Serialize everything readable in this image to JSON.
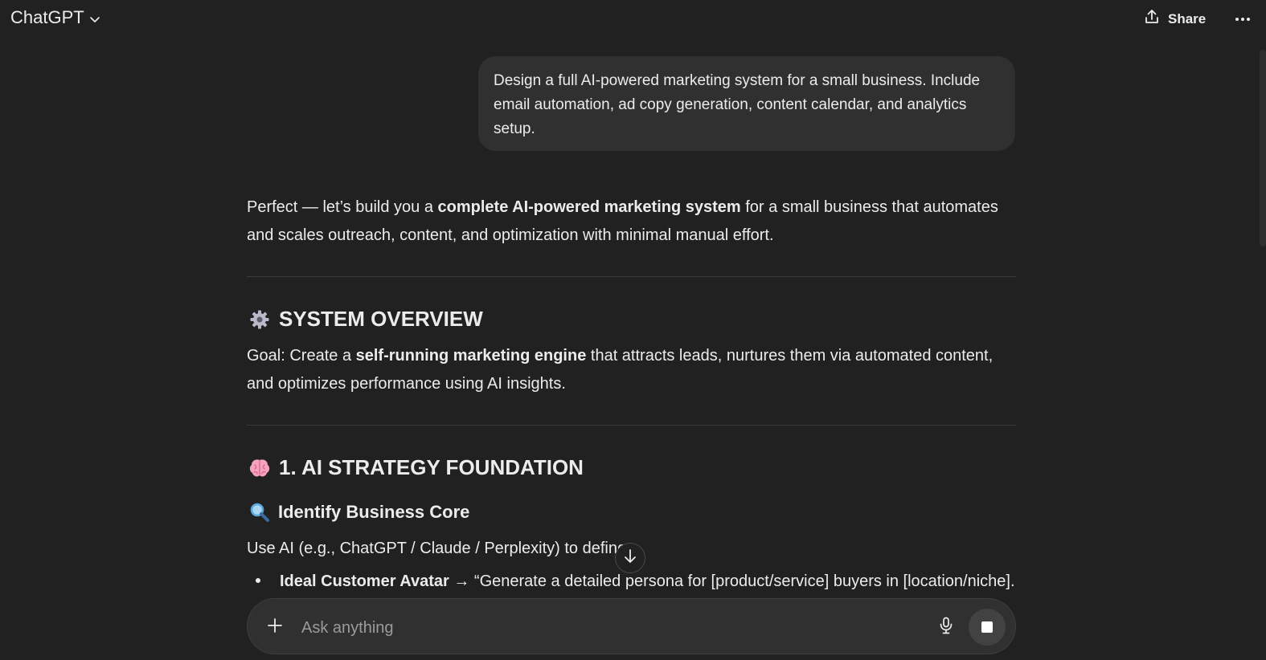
{
  "header": {
    "model_name": "ChatGPT",
    "share_label": "Share",
    "icons": [
      "chevron-down-icon",
      "share-icon",
      "more-icon"
    ]
  },
  "conversation": {
    "user_message": "Design a full AI-powered marketing system for a small business. Include email automation, ad copy generation, content calendar, and analytics setup.",
    "intro": {
      "pre": "Perfect — let’s build you a ",
      "bold": "complete AI-powered marketing system",
      "post": " for a small business that automates and scales outreach, content, and optimization with minimal manual effort."
    },
    "overview": {
      "heading": "SYSTEM OVERVIEW",
      "goal_pre": "Goal: Create a ",
      "goal_bold": "self-running marketing engine",
      "goal_post": " that attracts leads, nurtures them via automated content, and optimizes performance using AI insights."
    },
    "strategy": {
      "heading": "1. AI STRATEGY FOUNDATION",
      "subheading": "Identify Business Core",
      "use_ai": "Use AI (e.g., ChatGPT / Claude / Perplexity) to define:",
      "items": [
        {
          "bold": "Ideal Customer Avatar",
          "rest": " → “Generate a detailed persona for [product/service] buyers in [location/niche]."
        }
      ]
    }
  },
  "composer": {
    "placeholder": "Ask anything"
  },
  "colors": {
    "background": "#212121",
    "bubble": "#303030",
    "text": "#ececec"
  }
}
